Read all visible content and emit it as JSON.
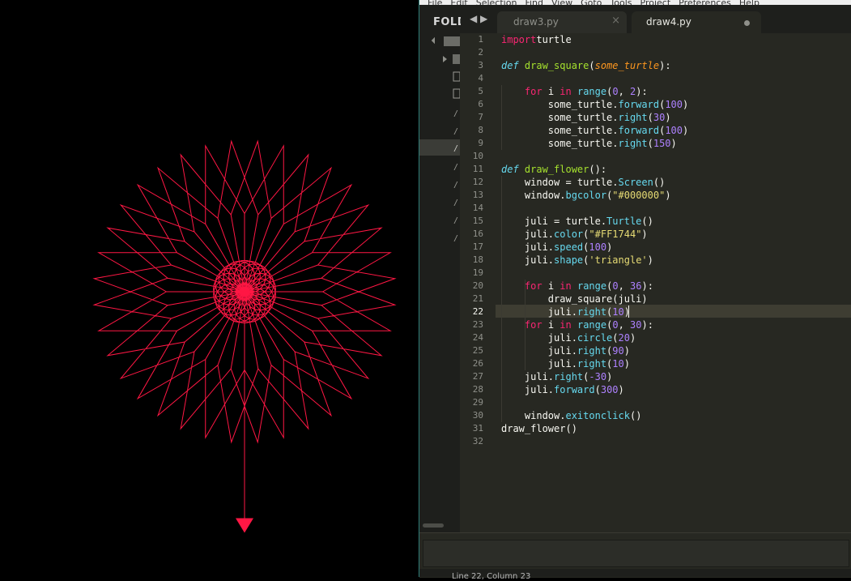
{
  "menubar": {
    "items": [
      "File",
      "Edit",
      "Selection",
      "Find",
      "View",
      "Goto",
      "Tools",
      "Project",
      "Preferences",
      "Help"
    ]
  },
  "sidebar": {
    "header": "FOLDERS"
  },
  "tabs": [
    {
      "label": "draw3.py",
      "active": false,
      "dirty": false
    },
    {
      "label": "draw4.py",
      "active": true,
      "dirty": true
    }
  ],
  "editor": {
    "active_line": 22,
    "lines": [
      [
        [
          "kw",
          "import"
        ],
        [
          "",
          "turtle"
        ]
      ],
      [],
      [
        [
          "def",
          "def"
        ],
        [
          "",
          ""
        ],
        [
          "fn",
          "draw_square"
        ],
        [
          "",
          "("
        ],
        [
          "param",
          "some_turtle"
        ],
        [
          "",
          "):"
        ]
      ],
      [],
      [
        [
          "",
          "    "
        ],
        [
          "kw",
          "for"
        ],
        [
          "",
          " i "
        ],
        [
          "kw",
          "in"
        ],
        [
          "",
          " "
        ],
        [
          "attr",
          "range"
        ],
        [
          "",
          "("
        ],
        [
          "num",
          "0"
        ],
        [
          "",
          ", "
        ],
        [
          "num",
          "2"
        ],
        [
          "",
          "):"
        ]
      ],
      [
        [
          "",
          "        some_turtle."
        ],
        [
          "attr",
          "forward"
        ],
        [
          "",
          "("
        ],
        [
          "num",
          "100"
        ],
        [
          "",
          ")"
        ]
      ],
      [
        [
          "",
          "        some_turtle."
        ],
        [
          "attr",
          "right"
        ],
        [
          "",
          "("
        ],
        [
          "num",
          "30"
        ],
        [
          "",
          ")"
        ]
      ],
      [
        [
          "",
          "        some_turtle."
        ],
        [
          "attr",
          "forward"
        ],
        [
          "",
          "("
        ],
        [
          "num",
          "100"
        ],
        [
          "",
          ")"
        ]
      ],
      [
        [
          "",
          "        some_turtle."
        ],
        [
          "attr",
          "right"
        ],
        [
          "",
          "("
        ],
        [
          "num",
          "150"
        ],
        [
          "",
          ")"
        ]
      ],
      [],
      [
        [
          "def",
          "def"
        ],
        [
          "",
          ""
        ],
        [
          "fn",
          "draw_flower"
        ],
        [
          "",
          "():"
        ]
      ],
      [
        [
          "",
          "    window = turtle."
        ],
        [
          "attr",
          "Screen"
        ],
        [
          "",
          "()"
        ]
      ],
      [
        [
          "",
          "    window."
        ],
        [
          "attr",
          "bgcolor"
        ],
        [
          "",
          "("
        ],
        [
          "str",
          "\"#000000\""
        ],
        [
          "",
          ")"
        ]
      ],
      [],
      [
        [
          "",
          "    juli = turtle."
        ],
        [
          "attr",
          "Turtle"
        ],
        [
          "",
          "()"
        ]
      ],
      [
        [
          "",
          "    juli."
        ],
        [
          "attr",
          "color"
        ],
        [
          "",
          "("
        ],
        [
          "str",
          "\"#FF1744\""
        ],
        [
          "",
          ")"
        ]
      ],
      [
        [
          "",
          "    juli."
        ],
        [
          "attr",
          "speed"
        ],
        [
          "",
          "("
        ],
        [
          "num",
          "100"
        ],
        [
          "",
          ")"
        ]
      ],
      [
        [
          "",
          "    juli."
        ],
        [
          "attr",
          "shape"
        ],
        [
          "",
          "("
        ],
        [
          "str",
          "'triangle'"
        ],
        [
          "",
          ")"
        ]
      ],
      [],
      [
        [
          "",
          "    "
        ],
        [
          "kw",
          "for"
        ],
        [
          "",
          " i "
        ],
        [
          "kw",
          "in"
        ],
        [
          "",
          " "
        ],
        [
          "attr",
          "range"
        ],
        [
          "",
          "("
        ],
        [
          "num",
          "0"
        ],
        [
          "",
          ", "
        ],
        [
          "num",
          "36"
        ],
        [
          "",
          "):"
        ]
      ],
      [
        [
          "",
          "        draw_square(juli)"
        ]
      ],
      [
        [
          "",
          "        juli."
        ],
        [
          "attr",
          "right"
        ],
        [
          "",
          "("
        ],
        [
          "num",
          "10"
        ],
        [
          "",
          ")"
        ]
      ],
      [
        [
          "",
          "    "
        ],
        [
          "kw",
          "for"
        ],
        [
          "",
          " i "
        ],
        [
          "kw",
          "in"
        ],
        [
          "",
          " "
        ],
        [
          "attr",
          "range"
        ],
        [
          "",
          "("
        ],
        [
          "num",
          "0"
        ],
        [
          "",
          ", "
        ],
        [
          "num",
          "30"
        ],
        [
          "",
          "):"
        ]
      ],
      [
        [
          "",
          "        juli."
        ],
        [
          "attr",
          "circle"
        ],
        [
          "",
          "("
        ],
        [
          "num",
          "20"
        ],
        [
          "",
          ")"
        ]
      ],
      [
        [
          "",
          "        juli."
        ],
        [
          "attr",
          "right"
        ],
        [
          "",
          "("
        ],
        [
          "num",
          "90"
        ],
        [
          "",
          ")"
        ]
      ],
      [
        [
          "",
          "        juli."
        ],
        [
          "attr",
          "right"
        ],
        [
          "",
          "("
        ],
        [
          "num",
          "10"
        ],
        [
          "",
          ")"
        ]
      ],
      [
        [
          "",
          "    juli."
        ],
        [
          "attr",
          "right"
        ],
        [
          "",
          "("
        ],
        [
          "num",
          "-30"
        ],
        [
          "",
          ")"
        ]
      ],
      [
        [
          "",
          "    juli."
        ],
        [
          "attr",
          "forward"
        ],
        [
          "",
          "("
        ],
        [
          "num",
          "300"
        ],
        [
          "",
          ")"
        ]
      ],
      [],
      [
        [
          "",
          "    window."
        ],
        [
          "attr",
          "exitonclick"
        ],
        [
          "",
          "()"
        ]
      ],
      [
        [
          "",
          "draw_flower()"
        ]
      ],
      []
    ]
  },
  "drawing": {
    "background": "#000000",
    "pen_color": "#FF1744",
    "squares": 36,
    "square_turn_deg": 10,
    "segment": 100,
    "circles": 30,
    "circle_radius": 20,
    "stem_length": 300
  },
  "statusbar": {
    "text": "Line 22, Column 23"
  }
}
